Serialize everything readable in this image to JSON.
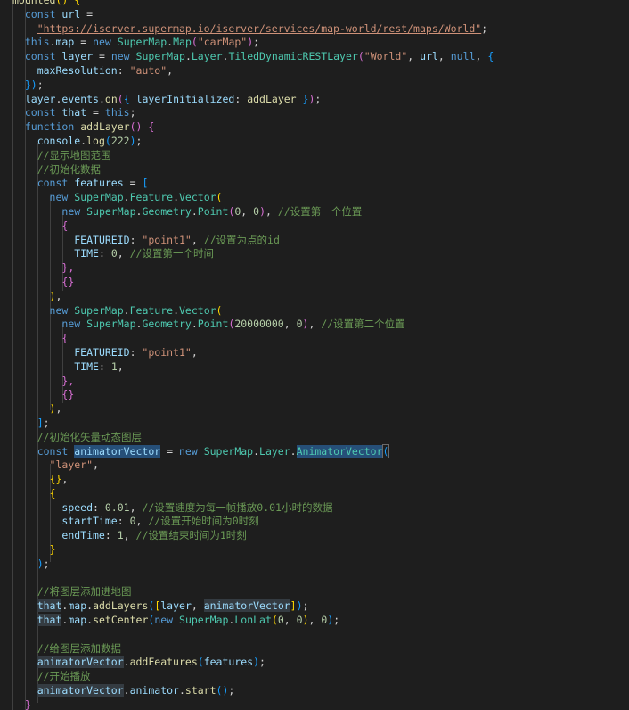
{
  "editor": {
    "language": "javascript",
    "lines": [
      [
        {
          "t": "mounted",
          "c": "fn"
        },
        {
          "t": "() {",
          "c": "p1"
        }
      ],
      [
        {
          "t": "  "
        },
        {
          "t": "const",
          "c": "kw"
        },
        {
          "t": " "
        },
        {
          "t": "url",
          "c": "var"
        },
        {
          "t": " ="
        }
      ],
      [
        {
          "t": "    "
        },
        {
          "t": "\"https://iserver.supermap.io/iserver/services/map-world/rest/maps/World\"",
          "c": "str url"
        },
        {
          "t": ";"
        }
      ],
      [
        {
          "t": "  "
        },
        {
          "t": "this",
          "c": "kw"
        },
        {
          "t": "."
        },
        {
          "t": "map",
          "c": "var"
        },
        {
          "t": " = "
        },
        {
          "t": "new",
          "c": "kw"
        },
        {
          "t": " "
        },
        {
          "t": "SuperMap",
          "c": "cls"
        },
        {
          "t": "."
        },
        {
          "t": "Map",
          "c": "cls"
        },
        {
          "t": "(",
          "c": "p2"
        },
        {
          "t": "\"carMap\"",
          "c": "str"
        },
        {
          "t": ")",
          "c": "p2"
        },
        {
          "t": ";"
        }
      ],
      [
        {
          "t": "  "
        },
        {
          "t": "const",
          "c": "kw"
        },
        {
          "t": " "
        },
        {
          "t": "layer",
          "c": "var"
        },
        {
          "t": " = "
        },
        {
          "t": "new",
          "c": "kw"
        },
        {
          "t": " "
        },
        {
          "t": "SuperMap",
          "c": "cls"
        },
        {
          "t": "."
        },
        {
          "t": "Layer",
          "c": "cls"
        },
        {
          "t": "."
        },
        {
          "t": "TiledDynamicRESTLayer",
          "c": "cls"
        },
        {
          "t": "(",
          "c": "p2"
        },
        {
          "t": "\"World\"",
          "c": "str"
        },
        {
          "t": ", "
        },
        {
          "t": "url",
          "c": "var"
        },
        {
          "t": ", "
        },
        {
          "t": "null",
          "c": "kw"
        },
        {
          "t": ", "
        },
        {
          "t": "{",
          "c": "p3"
        }
      ],
      [
        {
          "t": "    "
        },
        {
          "t": "maxResolution",
          "c": "var"
        },
        {
          "t": ": "
        },
        {
          "t": "\"auto\"",
          "c": "str"
        },
        {
          "t": ","
        }
      ],
      [
        {
          "t": "  "
        },
        {
          "t": "})",
          "c": "p3"
        },
        {
          "t": ";"
        }
      ],
      [
        {
          "t": "  "
        },
        {
          "t": "layer",
          "c": "var"
        },
        {
          "t": "."
        },
        {
          "t": "events",
          "c": "var"
        },
        {
          "t": "."
        },
        {
          "t": "on",
          "c": "fn"
        },
        {
          "t": "(",
          "c": "p2"
        },
        {
          "t": "{ ",
          "c": "p3"
        },
        {
          "t": "layerInitialized",
          "c": "var"
        },
        {
          "t": ": "
        },
        {
          "t": "addLayer",
          "c": "fn"
        },
        {
          "t": " }",
          "c": "p3"
        },
        {
          "t": ")",
          "c": "p2"
        },
        {
          "t": ";"
        }
      ],
      [
        {
          "t": "  "
        },
        {
          "t": "const",
          "c": "kw"
        },
        {
          "t": " "
        },
        {
          "t": "that",
          "c": "var"
        },
        {
          "t": " = "
        },
        {
          "t": "this",
          "c": "kw"
        },
        {
          "t": ";"
        }
      ],
      [
        {
          "t": "  "
        },
        {
          "t": "function",
          "c": "kw"
        },
        {
          "t": " "
        },
        {
          "t": "addLayer",
          "c": "fn"
        },
        {
          "t": "() {",
          "c": "p2"
        }
      ],
      [
        {
          "t": "    "
        },
        {
          "t": "console",
          "c": "var"
        },
        {
          "t": "."
        },
        {
          "t": "log",
          "c": "fn"
        },
        {
          "t": "(",
          "c": "p3"
        },
        {
          "t": "222",
          "c": "num"
        },
        {
          "t": ")",
          "c": "p3"
        },
        {
          "t": ";"
        }
      ],
      [
        {
          "t": "    "
        },
        {
          "t": "//显示地图范围",
          "c": "cmt"
        }
      ],
      [
        {
          "t": "    "
        },
        {
          "t": "//初始化数据",
          "c": "cmt"
        }
      ],
      [
        {
          "t": "    "
        },
        {
          "t": "const",
          "c": "kw"
        },
        {
          "t": " "
        },
        {
          "t": "features",
          "c": "var"
        },
        {
          "t": " = "
        },
        {
          "t": "[",
          "c": "p3"
        }
      ],
      [
        {
          "t": "      "
        },
        {
          "t": "new",
          "c": "kw"
        },
        {
          "t": " "
        },
        {
          "t": "SuperMap",
          "c": "cls"
        },
        {
          "t": "."
        },
        {
          "t": "Feature",
          "c": "cls"
        },
        {
          "t": "."
        },
        {
          "t": "Vector",
          "c": "cls"
        },
        {
          "t": "(",
          "c": "p1"
        }
      ],
      [
        {
          "t": "        "
        },
        {
          "t": "new",
          "c": "kw"
        },
        {
          "t": " "
        },
        {
          "t": "SuperMap",
          "c": "cls"
        },
        {
          "t": "."
        },
        {
          "t": "Geometry",
          "c": "cls"
        },
        {
          "t": "."
        },
        {
          "t": "Point",
          "c": "cls"
        },
        {
          "t": "(",
          "c": "p2"
        },
        {
          "t": "0",
          "c": "num"
        },
        {
          "t": ", "
        },
        {
          "t": "0",
          "c": "num"
        },
        {
          "t": ")",
          "c": "p2"
        },
        {
          "t": ", "
        },
        {
          "t": "//设置第一个位置",
          "c": "cmt"
        }
      ],
      [
        {
          "t": "        "
        },
        {
          "t": "{",
          "c": "p2"
        }
      ],
      [
        {
          "t": "          "
        },
        {
          "t": "FEATUREID",
          "c": "var"
        },
        {
          "t": ": "
        },
        {
          "t": "\"point1\"",
          "c": "str"
        },
        {
          "t": ", "
        },
        {
          "t": "//设置为点的id",
          "c": "cmt"
        }
      ],
      [
        {
          "t": "          "
        },
        {
          "t": "TIME",
          "c": "var"
        },
        {
          "t": ": "
        },
        {
          "t": "0",
          "c": "num"
        },
        {
          "t": ", "
        },
        {
          "t": "//设置第一个时间",
          "c": "cmt"
        }
      ],
      [
        {
          "t": "        "
        },
        {
          "t": "},",
          "c": "p2"
        }
      ],
      [
        {
          "t": "        "
        },
        {
          "t": "{}",
          "c": "p2"
        }
      ],
      [
        {
          "t": "      "
        },
        {
          "t": ")",
          "c": "p1"
        },
        {
          "t": ","
        }
      ],
      [
        {
          "t": "      "
        },
        {
          "t": "new",
          "c": "kw"
        },
        {
          "t": " "
        },
        {
          "t": "SuperMap",
          "c": "cls"
        },
        {
          "t": "."
        },
        {
          "t": "Feature",
          "c": "cls"
        },
        {
          "t": "."
        },
        {
          "t": "Vector",
          "c": "cls"
        },
        {
          "t": "(",
          "c": "p1"
        }
      ],
      [
        {
          "t": "        "
        },
        {
          "t": "new",
          "c": "kw"
        },
        {
          "t": " "
        },
        {
          "t": "SuperMap",
          "c": "cls"
        },
        {
          "t": "."
        },
        {
          "t": "Geometry",
          "c": "cls"
        },
        {
          "t": "."
        },
        {
          "t": "Point",
          "c": "cls"
        },
        {
          "t": "(",
          "c": "p2"
        },
        {
          "t": "20000000",
          "c": "num"
        },
        {
          "t": ", "
        },
        {
          "t": "0",
          "c": "num"
        },
        {
          "t": ")",
          "c": "p2"
        },
        {
          "t": ", "
        },
        {
          "t": "//设置第二个位置",
          "c": "cmt"
        }
      ],
      [
        {
          "t": "        "
        },
        {
          "t": "{",
          "c": "p2"
        }
      ],
      [
        {
          "t": "          "
        },
        {
          "t": "FEATUREID",
          "c": "var"
        },
        {
          "t": ": "
        },
        {
          "t": "\"point1\"",
          "c": "str"
        },
        {
          "t": ","
        }
      ],
      [
        {
          "t": "          "
        },
        {
          "t": "TIME",
          "c": "var"
        },
        {
          "t": ": "
        },
        {
          "t": "1",
          "c": "num"
        },
        {
          "t": ","
        }
      ],
      [
        {
          "t": "        "
        },
        {
          "t": "},",
          "c": "p2"
        }
      ],
      [
        {
          "t": "        "
        },
        {
          "t": "{}",
          "c": "p2"
        }
      ],
      [
        {
          "t": "      "
        },
        {
          "t": ")",
          "c": "p1"
        },
        {
          "t": ","
        }
      ],
      [
        {
          "t": "    "
        },
        {
          "t": "]",
          "c": "p3"
        },
        {
          "t": ";"
        }
      ],
      [
        {
          "t": "    "
        },
        {
          "t": "//初始化矢量动态图层",
          "c": "cmt"
        }
      ],
      [
        {
          "t": "    "
        },
        {
          "t": "const",
          "c": "kw"
        },
        {
          "t": " "
        },
        {
          "t": "animatorVector",
          "c": "var hl"
        },
        {
          "t": " = "
        },
        {
          "t": "new",
          "c": "kw"
        },
        {
          "t": " "
        },
        {
          "t": "SuperMap",
          "c": "cls"
        },
        {
          "t": "."
        },
        {
          "t": "Layer",
          "c": "cls"
        },
        {
          "t": "."
        },
        {
          "t": "AnimatorVector",
          "c": "cls hl"
        },
        {
          "t": "(",
          "c": "p3 box"
        }
      ],
      [
        {
          "t": "      "
        },
        {
          "t": "\"layer\"",
          "c": "str"
        },
        {
          "t": ","
        }
      ],
      [
        {
          "t": "      "
        },
        {
          "t": "{}",
          "c": "p1"
        },
        {
          "t": ","
        }
      ],
      [
        {
          "t": "      "
        },
        {
          "t": "{",
          "c": "p1"
        }
      ],
      [
        {
          "t": "        "
        },
        {
          "t": "speed",
          "c": "var"
        },
        {
          "t": ": "
        },
        {
          "t": "0.01",
          "c": "num"
        },
        {
          "t": ", "
        },
        {
          "t": "//设置速度为每一帧播放0.01小时的数据",
          "c": "cmt"
        }
      ],
      [
        {
          "t": "        "
        },
        {
          "t": "startTime",
          "c": "var"
        },
        {
          "t": ": "
        },
        {
          "t": "0",
          "c": "num"
        },
        {
          "t": ", "
        },
        {
          "t": "//设置开始时间为0时刻",
          "c": "cmt"
        }
      ],
      [
        {
          "t": "        "
        },
        {
          "t": "endTime",
          "c": "var"
        },
        {
          "t": ": "
        },
        {
          "t": "1",
          "c": "num"
        },
        {
          "t": ", "
        },
        {
          "t": "//设置结束时间为1时刻",
          "c": "cmt"
        }
      ],
      [
        {
          "t": "      "
        },
        {
          "t": "}",
          "c": "p1"
        }
      ],
      [
        {
          "t": "    "
        },
        {
          "t": ")",
          "c": "p3"
        },
        {
          "t": ";"
        }
      ],
      [
        {
          "t": ""
        }
      ],
      [
        {
          "t": "    "
        },
        {
          "t": "//将图层添加进地图",
          "c": "cmt"
        }
      ],
      [
        {
          "t": "    "
        },
        {
          "t": "that",
          "c": "var hl2"
        },
        {
          "t": "."
        },
        {
          "t": "map",
          "c": "var"
        },
        {
          "t": "."
        },
        {
          "t": "addLayers",
          "c": "fn"
        },
        {
          "t": "(",
          "c": "p3"
        },
        {
          "t": "[",
          "c": "p1"
        },
        {
          "t": "layer",
          "c": "var"
        },
        {
          "t": ", "
        },
        {
          "t": "animatorVector",
          "c": "var hl2"
        },
        {
          "t": "]",
          "c": "p1"
        },
        {
          "t": ")",
          "c": "p3"
        },
        {
          "t": ";"
        }
      ],
      [
        {
          "t": "    "
        },
        {
          "t": "that",
          "c": "var hl2"
        },
        {
          "t": "."
        },
        {
          "t": "map",
          "c": "var"
        },
        {
          "t": "."
        },
        {
          "t": "setCenter",
          "c": "fn"
        },
        {
          "t": "(",
          "c": "p3"
        },
        {
          "t": "new",
          "c": "kw"
        },
        {
          "t": " "
        },
        {
          "t": "SuperMap",
          "c": "cls"
        },
        {
          "t": "."
        },
        {
          "t": "LonLat",
          "c": "cls"
        },
        {
          "t": "(",
          "c": "p1"
        },
        {
          "t": "0",
          "c": "num"
        },
        {
          "t": ", "
        },
        {
          "t": "0",
          "c": "num"
        },
        {
          "t": ")",
          "c": "p1"
        },
        {
          "t": ", "
        },
        {
          "t": "0",
          "c": "num"
        },
        {
          "t": ")",
          "c": "p3"
        },
        {
          "t": ";"
        }
      ],
      [
        {
          "t": ""
        }
      ],
      [
        {
          "t": "    "
        },
        {
          "t": "//给图层添加数据",
          "c": "cmt"
        }
      ],
      [
        {
          "t": "    "
        },
        {
          "t": "animatorVector",
          "c": "var hl2"
        },
        {
          "t": "."
        },
        {
          "t": "addFeatures",
          "c": "fn"
        },
        {
          "t": "(",
          "c": "p3"
        },
        {
          "t": "features",
          "c": "var"
        },
        {
          "t": ")",
          "c": "p3"
        },
        {
          "t": ";"
        }
      ],
      [
        {
          "t": "    "
        },
        {
          "t": "//开始播放",
          "c": "cmt"
        }
      ],
      [
        {
          "t": "    "
        },
        {
          "t": "animatorVector",
          "c": "var hl2"
        },
        {
          "t": "."
        },
        {
          "t": "animator",
          "c": "var"
        },
        {
          "t": "."
        },
        {
          "t": "start",
          "c": "fn"
        },
        {
          "t": "()",
          "c": "p3"
        },
        {
          "t": ";"
        }
      ],
      [
        {
          "t": "  "
        },
        {
          "t": "}",
          "c": "p2"
        }
      ]
    ]
  }
}
